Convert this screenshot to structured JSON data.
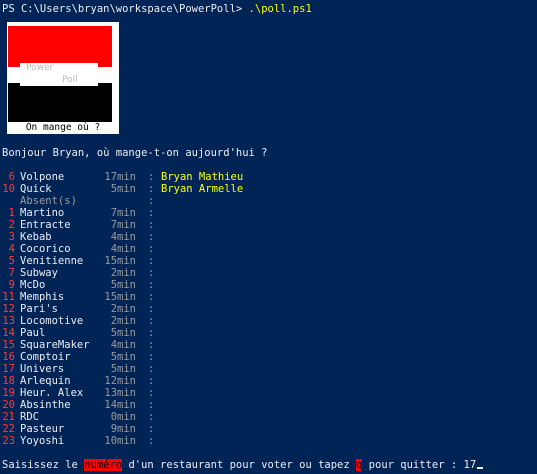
{
  "terminal": {
    "prompt_path": "PS C:\\Users\\bryan\\workspace\\PowerPoll> ",
    "command": ".\\poll.ps1"
  },
  "logo": {
    "word1": "Power",
    "word2": "Poll",
    "caption": "On mange où ?",
    "colors": {
      "top": "#ff0000",
      "bottom": "#000000",
      "frame": "#ffffff"
    }
  },
  "greeting": "Bonjour Bryan, où mange-t-on aujourd'hui ?",
  "restaurants": [
    {
      "num": "6",
      "name": "Volpone",
      "time": "17min",
      "voters": "Bryan Mathieu"
    },
    {
      "num": "10",
      "name": "Quick",
      "time": "5min",
      "voters": "Bryan Armelle"
    },
    {
      "num": "",
      "name": "Absent(s)",
      "time": "",
      "voters": ""
    },
    {
      "num": "1",
      "name": "Martino",
      "time": "7min",
      "voters": ""
    },
    {
      "num": "2",
      "name": "Entracte",
      "time": "7min",
      "voters": ""
    },
    {
      "num": "3",
      "name": "Kebab",
      "time": "4min",
      "voters": ""
    },
    {
      "num": "4",
      "name": "Cocorico",
      "time": "4min",
      "voters": ""
    },
    {
      "num": "5",
      "name": "Venitienne",
      "time": "15min",
      "voters": ""
    },
    {
      "num": "7",
      "name": "Subway",
      "time": "2min",
      "voters": ""
    },
    {
      "num": "9",
      "name": "McDo",
      "time": "5min",
      "voters": ""
    },
    {
      "num": "11",
      "name": "Memphis",
      "time": "15min",
      "voters": ""
    },
    {
      "num": "12",
      "name": "Pari's",
      "time": "2min",
      "voters": ""
    },
    {
      "num": "13",
      "name": "Locomotive",
      "time": "2min",
      "voters": ""
    },
    {
      "num": "14",
      "name": "Paul",
      "time": "5min",
      "voters": ""
    },
    {
      "num": "15",
      "name": "SquareMaker",
      "time": "4min",
      "voters": ""
    },
    {
      "num": "16",
      "name": "Comptoir",
      "time": "5min",
      "voters": ""
    },
    {
      "num": "17",
      "name": "Univers",
      "time": "5min",
      "voters": ""
    },
    {
      "num": "18",
      "name": "Arlequin",
      "time": "12min",
      "voters": ""
    },
    {
      "num": "19",
      "name": "Heur. Alex",
      "time": "13min",
      "voters": ""
    },
    {
      "num": "20",
      "name": "Absinthe",
      "time": "14min",
      "voters": ""
    },
    {
      "num": "21",
      "name": "RDC",
      "time": "0min",
      "voters": ""
    },
    {
      "num": "22",
      "name": "Pasteur",
      "time": "9min",
      "voters": ""
    },
    {
      "num": "23",
      "name": "Yoyoshi",
      "time": "10min",
      "voters": ""
    }
  ],
  "footer": {
    "part1": "Saisissez le ",
    "highlight1": "numéro",
    "part2": " d'un restaurant pour voter ou tapez ",
    "highlight2": "q",
    "part3": " pour quitter : ",
    "input_value": "17"
  },
  "colors": {
    "background": "#012456",
    "text": "#eeedf0",
    "number": "#ff3b3b",
    "voters": "#ffff00",
    "dim": "#9c9c9c"
  }
}
